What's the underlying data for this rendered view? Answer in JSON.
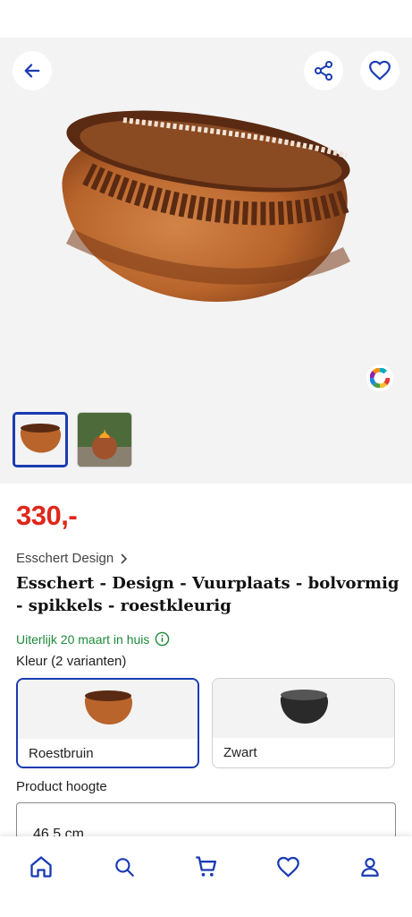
{
  "header": {
    "back_icon": "arrow-left-icon",
    "share_icon": "share-icon",
    "favorite_icon": "heart-icon"
  },
  "gallery": {
    "thumbnails": [
      {
        "icon": "product-thumbnail",
        "selected": true
      },
      {
        "icon": "product-in-garden-thumbnail",
        "selected": false
      }
    ],
    "color_wheel_icon": "color-wheel-icon"
  },
  "product": {
    "price": "330,-",
    "brand": "Esschert Design",
    "title": "Esschert - Design - Vuurplaats - bolvormig - spikkels - roestkleurig",
    "delivery": "Uiterlijk 20 maart in huis",
    "variants_label": "Kleur (2 varianten)",
    "variants": [
      {
        "label": "Roestbruin",
        "selected": true
      },
      {
        "label": "Zwart",
        "selected": false
      }
    ],
    "height_label": "Product hoogte",
    "height_value": "46,5 cm"
  },
  "nav": {
    "items": [
      "home-icon",
      "search-icon",
      "cart-icon",
      "wishlist-icon",
      "account-icon"
    ],
    "active": "home-icon"
  },
  "colors": {
    "accent": "#1a3bb3",
    "price": "#e0261a",
    "delivery": "#1d8a3a",
    "rust": "#b8642b"
  }
}
